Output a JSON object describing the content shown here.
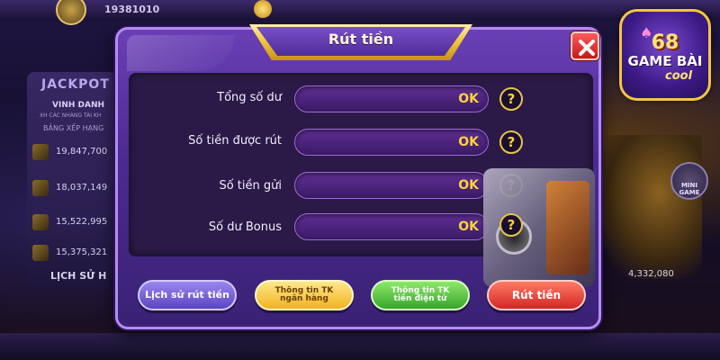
{
  "background": {
    "user_id": "19381010",
    "jackpot_label": "JACKPOT",
    "honor_title": "VINH DANH",
    "honor_sub": "XH CÁC NHÀNG TÀI KH",
    "ranking_label": "BẢNG XẾP HẠNG",
    "rows": [
      "19,847,700",
      "18,037,149",
      "15,522,995",
      "15,375,321"
    ],
    "history_label": "LỊCH SỬ H",
    "right_amount": "4,332,080",
    "mini_game_label": "MINI GAME"
  },
  "logo": {
    "number": "68",
    "main": "GAME BÀI",
    "sub": "cool"
  },
  "dialog": {
    "title": "Rút tiền",
    "rows": [
      {
        "label": "Tổng số dư",
        "value": "OK"
      },
      {
        "label": "Số tiền được rút",
        "value": "OK"
      },
      {
        "label": "Số tiền gửi",
        "value": "OK"
      },
      {
        "label": "Số dư Bonus",
        "value": "OK"
      }
    ],
    "help_glyph": "?",
    "buttons": {
      "history": "Lịch sử rút tiền",
      "bank_line1": "Thông tin TK",
      "bank_line2": "ngân hàng",
      "ewallet_line1": "Thông tin TK",
      "ewallet_line2": "tiền điện tử",
      "withdraw": "Rút tiền"
    }
  },
  "colors": {
    "dialog_bg": "#4a2a8f",
    "title_gold": "#f3c740",
    "value_text": "#ffd23a",
    "close_red": "#c21a1a"
  },
  "icons": {
    "close": "close-icon",
    "help": "question-mark-icon",
    "safe": "safe-icon"
  }
}
